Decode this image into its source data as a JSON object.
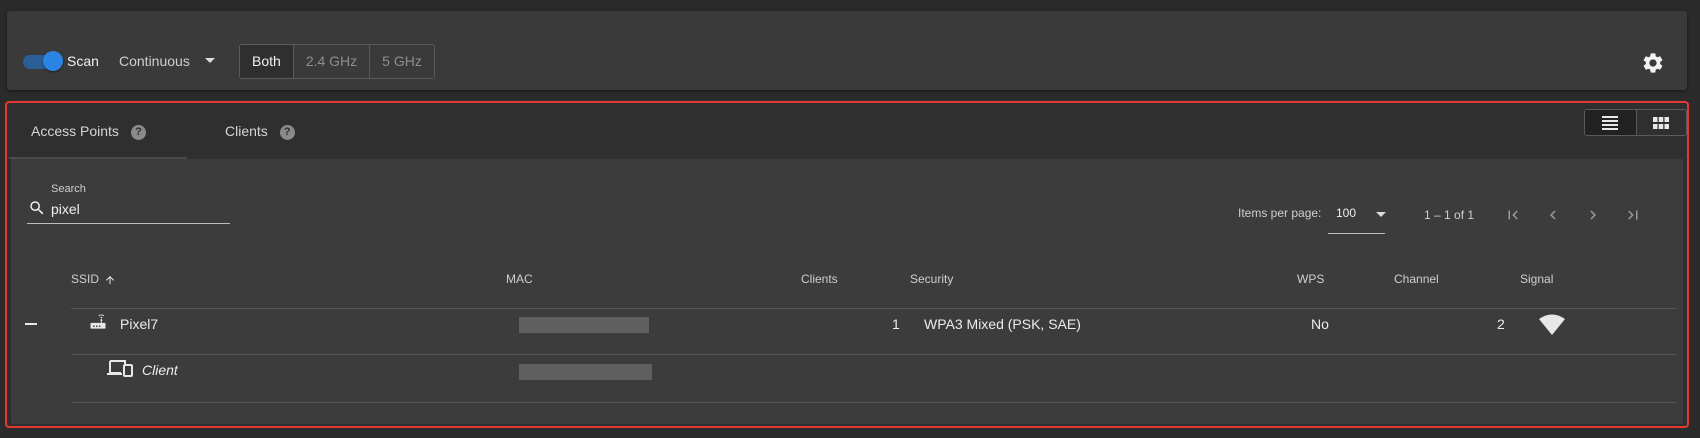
{
  "toolbar": {
    "scan_label": "Scan",
    "scan_enabled": true,
    "mode": "Continuous",
    "bands": [
      "Both",
      "2.4 GHz",
      "5 GHz"
    ],
    "selected_band": "Both",
    "settings_icon": "gear-icon"
  },
  "tabs": [
    {
      "label": "Access Points",
      "active": true
    },
    {
      "label": "Clients",
      "active": false
    }
  ],
  "help_glyph": "?",
  "view_modes": [
    "list-view-icon",
    "grid-view-icon"
  ],
  "search": {
    "caption": "Search",
    "value": "pixel"
  },
  "pagination": {
    "items_per_page_label": "Items per page:",
    "items_per_page": "100",
    "range": "1 – 1 of 1"
  },
  "table": {
    "columns": [
      "SSID",
      "MAC",
      "Clients",
      "Security",
      "WPS",
      "Channel",
      "Signal"
    ],
    "sorted_by": "SSID",
    "sort_direction": "ascending",
    "rows": [
      {
        "ssid": "Pixel7",
        "mac_redacted": true,
        "clients": "1",
        "security": "WPA3 Mixed (PSK, SAE)",
        "wps": "No",
        "channel": "2",
        "signal_icon": "wifi-signal-icon"
      }
    ],
    "child_rows": [
      {
        "name": "Client",
        "mac_redacted": true
      }
    ]
  },
  "colors": {
    "accent": "#2b84e3",
    "highlight_border": "#e53935",
    "background": "#2b2b2b"
  }
}
